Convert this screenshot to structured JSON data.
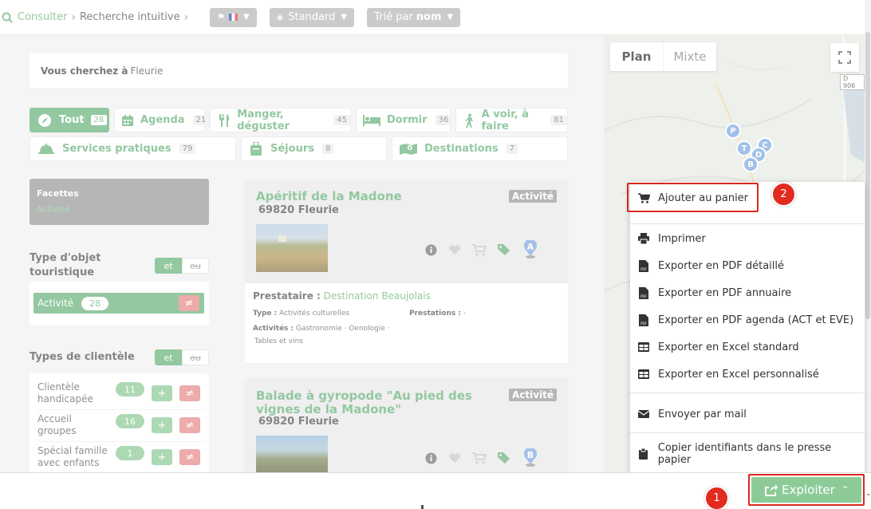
{
  "breadcrumb": {
    "root": "Consulter",
    "current": "Recherche intuitive"
  },
  "filters": {
    "display_mode": "Standard",
    "sort_prefix": "Trié par",
    "sort_value": "nom"
  },
  "search": {
    "prefix": "Vous cherchez à",
    "place": "Fleurie"
  },
  "tabs": [
    {
      "label": "Tout",
      "count": "28",
      "icon": "compass-icon",
      "active": true
    },
    {
      "label": "Agenda",
      "count": "21",
      "icon": "calendar-icon"
    },
    {
      "label": "Manger, déguster",
      "count": "45",
      "icon": "cutlery-icon"
    },
    {
      "label": "Dormir",
      "count": "36",
      "icon": "bed-icon"
    },
    {
      "label": "A voir, à faire",
      "count": "81",
      "icon": "hiker-icon"
    },
    {
      "label": "Services pratiques",
      "count": "79",
      "icon": "bell-icon"
    },
    {
      "label": "Séjours",
      "count": "8",
      "icon": "suitcase-icon"
    },
    {
      "label": "Destinations",
      "count": "7",
      "icon": "map-icon"
    }
  ],
  "facets": {
    "title": "Facettes",
    "selected": "Activité",
    "type_title": "Type d'objet touristique",
    "and": "et",
    "or": "ou",
    "type_item": {
      "label": "Activité",
      "count": "28",
      "neq": "≠"
    },
    "clientele_title": "Types de clientèle",
    "clientele": [
      {
        "label": "Clientèle handicapée",
        "count": "11"
      },
      {
        "label": "Accueil groupes",
        "count": "16"
      },
      {
        "label": "Spécial famille avec enfants",
        "count": "1"
      }
    ],
    "plus": "+",
    "neq": "≠"
  },
  "results": [
    {
      "title": "Apéritif de la Madone",
      "city": "69820 Fleurie",
      "kind": "Activité",
      "marker": "A",
      "prestataire_label": "Prestataire :",
      "prestataire": "Destination Beaujolais",
      "type_label": "Type :",
      "type": "Activités culturelles",
      "prestations_label": "Prestations :",
      "prestations": "-",
      "activites_label": "Activités :",
      "activites_1": "Gastronomie · Oenologie ·",
      "activites_2": "Tables et vins"
    },
    {
      "title": "Balade à gyropode \"Au pied des vignes de la Madone\"",
      "city": "69820 Fleurie",
      "kind": "Activité",
      "marker": "B"
    }
  ],
  "map": {
    "plan": "Plan",
    "mixte": "Mixte",
    "road": "D 906",
    "pins": [
      "P",
      "T",
      "C",
      "D",
      "B"
    ]
  },
  "menu": {
    "items": [
      {
        "label": "Ajouter au panier",
        "icon": "cart-icon"
      },
      {
        "label": "Imprimer",
        "icon": "printer-icon"
      },
      {
        "label": "Exporter en PDF détaillé",
        "icon": "pdf-icon"
      },
      {
        "label": "Exporter en PDF annuaire",
        "icon": "pdf-icon"
      },
      {
        "label": "Exporter en PDF agenda (ACT et EVE)",
        "icon": "pdf-icon"
      },
      {
        "label": "Exporter en Excel standard",
        "icon": "table-icon"
      },
      {
        "label": "Exporter en Excel personnalisé",
        "icon": "table-icon"
      },
      {
        "label": "Envoyer par mail",
        "icon": "envelope-icon"
      },
      {
        "label": "Copier identifiants dans le presse papier",
        "icon": "clipboard-icon"
      }
    ]
  },
  "exploit_button": "Exploiter",
  "annotations": {
    "step1": "1",
    "step2": "2",
    "highlight_color": "#d9281e"
  },
  "colors": {
    "accent": "#6ab37c",
    "accent_light": "#8ccb98",
    "danger": "#e68b8b"
  }
}
